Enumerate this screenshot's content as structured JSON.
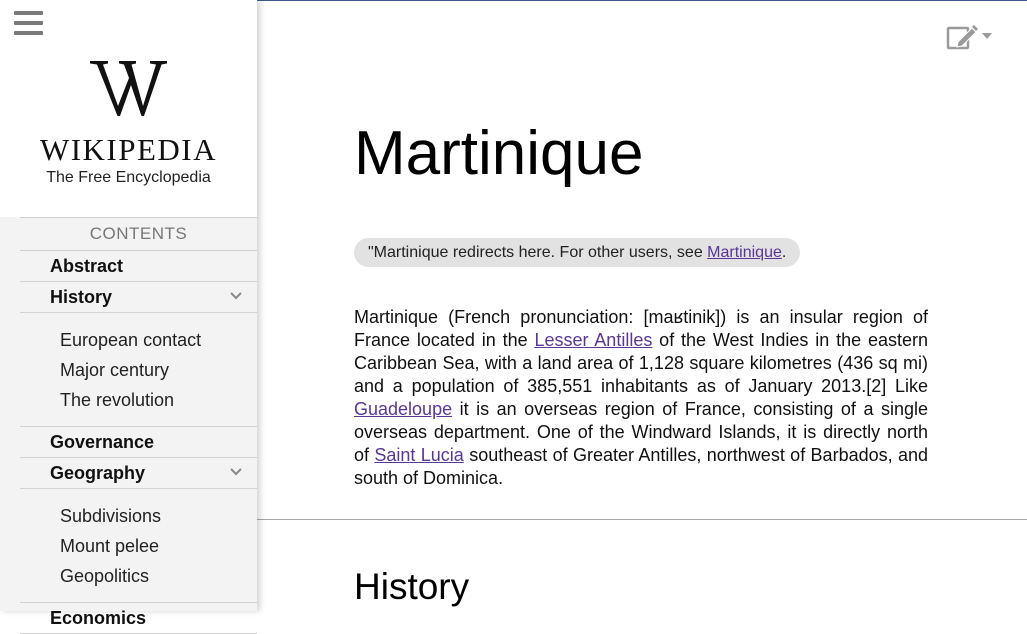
{
  "sidebar": {
    "wordmark": "WIKIPEDIA",
    "tagline": "The Free Encyclopedia",
    "contents_title": "CONTENTS",
    "items": [
      {
        "label": "Abstract"
      },
      {
        "label": "History",
        "subitems": [
          "European contact",
          "Major century",
          "The revolution"
        ]
      },
      {
        "label": "Governance"
      },
      {
        "label": "Geography",
        "subitems": [
          "Subdivisions",
          "Mount pelee",
          "Geopolitics"
        ]
      },
      {
        "label": "Economics"
      }
    ]
  },
  "article": {
    "title": "Martinique",
    "hatnote": {
      "prefix": "\"Martinique redirects here. For other users, see ",
      "link": "Martinique",
      "suffix": "."
    },
    "intro": {
      "t1": "Martinique (French pronunciation: [maʁtinik]) is an insular region of France located in the ",
      "l1": "Lesser Antilles",
      "t2": " of the West Indies in the eastern Caribbean Sea, with a land area of 1,128 square kilometres (436 sq mi) and a population of 385,551 inhabitants as of January 2013.[2] Like ",
      "l2": "Guadeloupe",
      "t3": " it is an overseas region of France, consisting of a single overseas department. One of the Windward Islands, it is directly north of ",
      "l3": "Saint Lucia",
      "t4": " southeast of Greater Antilles, northwest of Barbados, and south of Dominica."
    },
    "section_heading": "History"
  },
  "icons": {
    "menu": "hamburger-icon",
    "edit": "edit-icon",
    "dropdown": "chevron-down-icon"
  },
  "colors": {
    "link_visited": "#5a3696",
    "sidebar_bg": "#f3f3f3",
    "hatnote_bg": "#e2e2e2"
  }
}
